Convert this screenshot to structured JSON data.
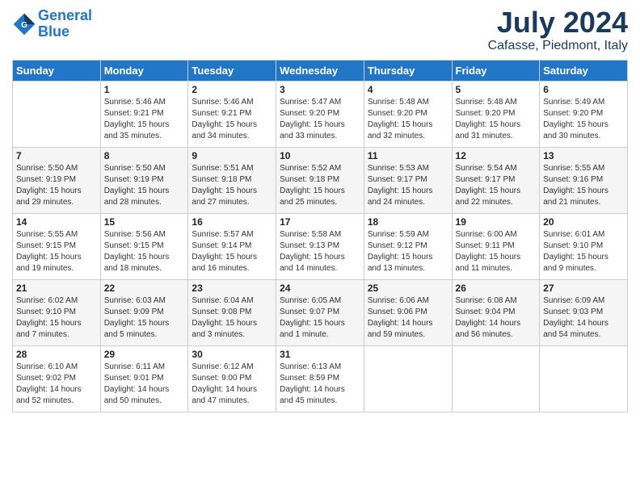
{
  "header": {
    "logo_line1": "General",
    "logo_line2": "Blue",
    "title": "July 2024",
    "location": "Cafasse, Piedmont, Italy"
  },
  "days_of_week": [
    "Sunday",
    "Monday",
    "Tuesday",
    "Wednesday",
    "Thursday",
    "Friday",
    "Saturday"
  ],
  "weeks": [
    [
      {
        "num": "",
        "info": ""
      },
      {
        "num": "1",
        "info": "Sunrise: 5:46 AM\nSunset: 9:21 PM\nDaylight: 15 hours\nand 35 minutes."
      },
      {
        "num": "2",
        "info": "Sunrise: 5:46 AM\nSunset: 9:21 PM\nDaylight: 15 hours\nand 34 minutes."
      },
      {
        "num": "3",
        "info": "Sunrise: 5:47 AM\nSunset: 9:20 PM\nDaylight: 15 hours\nand 33 minutes."
      },
      {
        "num": "4",
        "info": "Sunrise: 5:48 AM\nSunset: 9:20 PM\nDaylight: 15 hours\nand 32 minutes."
      },
      {
        "num": "5",
        "info": "Sunrise: 5:48 AM\nSunset: 9:20 PM\nDaylight: 15 hours\nand 31 minutes."
      },
      {
        "num": "6",
        "info": "Sunrise: 5:49 AM\nSunset: 9:20 PM\nDaylight: 15 hours\nand 30 minutes."
      }
    ],
    [
      {
        "num": "7",
        "info": "Sunrise: 5:50 AM\nSunset: 9:19 PM\nDaylight: 15 hours\nand 29 minutes."
      },
      {
        "num": "8",
        "info": "Sunrise: 5:50 AM\nSunset: 9:19 PM\nDaylight: 15 hours\nand 28 minutes."
      },
      {
        "num": "9",
        "info": "Sunrise: 5:51 AM\nSunset: 9:18 PM\nDaylight: 15 hours\nand 27 minutes."
      },
      {
        "num": "10",
        "info": "Sunrise: 5:52 AM\nSunset: 9:18 PM\nDaylight: 15 hours\nand 25 minutes."
      },
      {
        "num": "11",
        "info": "Sunrise: 5:53 AM\nSunset: 9:17 PM\nDaylight: 15 hours\nand 24 minutes."
      },
      {
        "num": "12",
        "info": "Sunrise: 5:54 AM\nSunset: 9:17 PM\nDaylight: 15 hours\nand 22 minutes."
      },
      {
        "num": "13",
        "info": "Sunrise: 5:55 AM\nSunset: 9:16 PM\nDaylight: 15 hours\nand 21 minutes."
      }
    ],
    [
      {
        "num": "14",
        "info": "Sunrise: 5:55 AM\nSunset: 9:15 PM\nDaylight: 15 hours\nand 19 minutes."
      },
      {
        "num": "15",
        "info": "Sunrise: 5:56 AM\nSunset: 9:15 PM\nDaylight: 15 hours\nand 18 minutes."
      },
      {
        "num": "16",
        "info": "Sunrise: 5:57 AM\nSunset: 9:14 PM\nDaylight: 15 hours\nand 16 minutes."
      },
      {
        "num": "17",
        "info": "Sunrise: 5:58 AM\nSunset: 9:13 PM\nDaylight: 15 hours\nand 14 minutes."
      },
      {
        "num": "18",
        "info": "Sunrise: 5:59 AM\nSunset: 9:12 PM\nDaylight: 15 hours\nand 13 minutes."
      },
      {
        "num": "19",
        "info": "Sunrise: 6:00 AM\nSunset: 9:11 PM\nDaylight: 15 hours\nand 11 minutes."
      },
      {
        "num": "20",
        "info": "Sunrise: 6:01 AM\nSunset: 9:10 PM\nDaylight: 15 hours\nand 9 minutes."
      }
    ],
    [
      {
        "num": "21",
        "info": "Sunrise: 6:02 AM\nSunset: 9:10 PM\nDaylight: 15 hours\nand 7 minutes."
      },
      {
        "num": "22",
        "info": "Sunrise: 6:03 AM\nSunset: 9:09 PM\nDaylight: 15 hours\nand 5 minutes."
      },
      {
        "num": "23",
        "info": "Sunrise: 6:04 AM\nSunset: 9:08 PM\nDaylight: 15 hours\nand 3 minutes."
      },
      {
        "num": "24",
        "info": "Sunrise: 6:05 AM\nSunset: 9:07 PM\nDaylight: 15 hours\nand 1 minute."
      },
      {
        "num": "25",
        "info": "Sunrise: 6:06 AM\nSunset: 9:06 PM\nDaylight: 14 hours\nand 59 minutes."
      },
      {
        "num": "26",
        "info": "Sunrise: 6:08 AM\nSunset: 9:04 PM\nDaylight: 14 hours\nand 56 minutes."
      },
      {
        "num": "27",
        "info": "Sunrise: 6:09 AM\nSunset: 9:03 PM\nDaylight: 14 hours\nand 54 minutes."
      }
    ],
    [
      {
        "num": "28",
        "info": "Sunrise: 6:10 AM\nSunset: 9:02 PM\nDaylight: 14 hours\nand 52 minutes."
      },
      {
        "num": "29",
        "info": "Sunrise: 6:11 AM\nSunset: 9:01 PM\nDaylight: 14 hours\nand 50 minutes."
      },
      {
        "num": "30",
        "info": "Sunrise: 6:12 AM\nSunset: 9:00 PM\nDaylight: 14 hours\nand 47 minutes."
      },
      {
        "num": "31",
        "info": "Sunrise: 6:13 AM\nSunset: 8:59 PM\nDaylight: 14 hours\nand 45 minutes."
      },
      {
        "num": "",
        "info": ""
      },
      {
        "num": "",
        "info": ""
      },
      {
        "num": "",
        "info": ""
      }
    ]
  ]
}
